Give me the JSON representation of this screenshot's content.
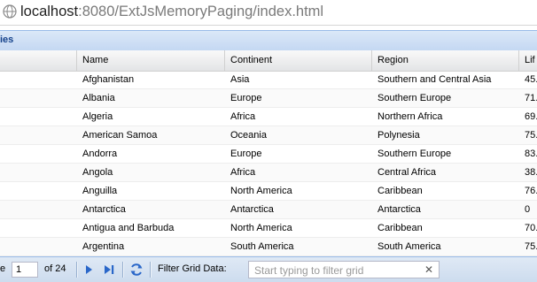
{
  "browser": {
    "url_host": "localhost",
    "url_rest": ":8080/ExtJsMemoryPaging/index.html"
  },
  "panel": {
    "title_fragment": "ies"
  },
  "grid": {
    "columns": [
      "Name",
      "Continent",
      "Region",
      "Lif"
    ],
    "rows": [
      [
        "Afghanistan",
        "Asia",
        "Southern and Central Asia",
        "45."
      ],
      [
        "Albania",
        "Europe",
        "Southern Europe",
        "71."
      ],
      [
        "Algeria",
        "Africa",
        "Northern Africa",
        "69."
      ],
      [
        "American Samoa",
        "Oceania",
        "Polynesia",
        "75."
      ],
      [
        "Andorra",
        "Europe",
        "Southern Europe",
        "83."
      ],
      [
        "Angola",
        "Africa",
        "Central Africa",
        "38."
      ],
      [
        "Anguilla",
        "North America",
        "Caribbean",
        "76."
      ],
      [
        "Antarctica",
        "Antarctica",
        "Antarctica",
        "0"
      ],
      [
        "Antigua and Barbuda",
        "North America",
        "Caribbean",
        "70."
      ],
      [
        "Argentina",
        "South America",
        "South America",
        "75."
      ]
    ]
  },
  "pager": {
    "page_label_fragment": "e",
    "current_page": "1",
    "of_label": "of 24",
    "filter_label": "Filter Grid Data:",
    "filter_placeholder": "Start typing to filter grid",
    "clear_glyph": "✕"
  }
}
